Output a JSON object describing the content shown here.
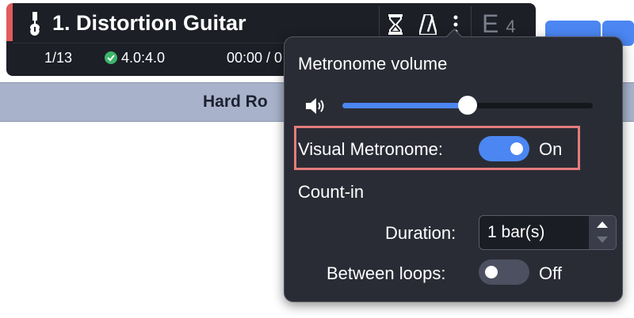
{
  "track": {
    "title": "1. Distortion Guitar",
    "accent_color": "#e25c5c",
    "tools": [
      "hourglass-icon",
      "metronome-icon",
      "more-vertical-icon"
    ],
    "key_note": "E",
    "key_octave": "4",
    "bar_count": "1/13",
    "time_signature": "4.0:4.0",
    "time_position": "00:00 / 0"
  },
  "section": {
    "name": "Hard Ro"
  },
  "popover": {
    "metronome_volume_label": "Metronome volume",
    "volume_level": 0.5,
    "visual_metronome_label": "Visual Metronome:",
    "visual_metronome_state": "On",
    "count_in_label": "Count-in",
    "duration_label": "Duration:",
    "duration_value": "1 bar(s)",
    "between_loops_label": "Between loops:",
    "between_loops_state": "Off"
  },
  "colors": {
    "panel_bg": "#1d1f27",
    "popover_bg": "#2a2c35",
    "accent_blue": "#4b86f2",
    "toggle_off": "#4d5060",
    "section_band": "#a8b3cb",
    "highlight": "#e47c7c"
  }
}
